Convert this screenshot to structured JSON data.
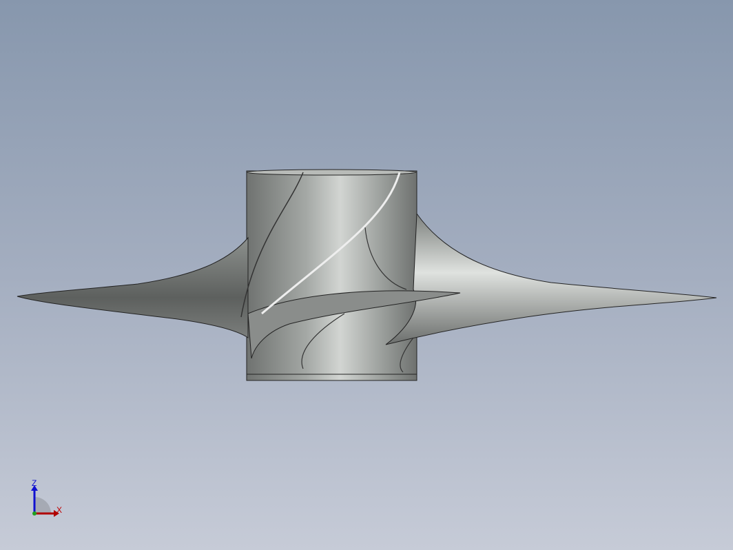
{
  "viewport": {
    "model": "propeller-impeller",
    "triad": {
      "z_label": "Z",
      "x_label": "X",
      "z_color": "#1010d0",
      "x_color": "#c00000",
      "origin_color": "#20a020"
    }
  }
}
